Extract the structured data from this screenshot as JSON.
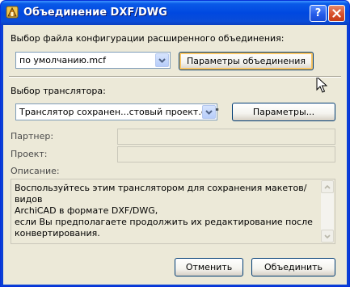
{
  "window": {
    "title": "Объединение DXF/DWG",
    "help_button": "?",
    "close_button": "×",
    "icons": {
      "app": "archicad-app-icon",
      "help": "help-icon",
      "close": "close-icon"
    }
  },
  "config_section": {
    "label": "Выбор файла конфигурации расширенного объединения:",
    "select_value": "по умолчанию.mcf",
    "settings_button": "Параметры объединения"
  },
  "translator_section": {
    "label": "Выбор транслятора:",
    "select_value": "Транслятор сохранен...стовый проект.dxf\"",
    "params_button": "Параметры..."
  },
  "info": {
    "partner_label": "Партнер:",
    "partner_value": "",
    "project_label": "Проект:",
    "project_value": "",
    "description_label": "Описание:",
    "description_lines": [
      "Воспользуйтесь этим транслятором для сохранения макетов/видов",
      "ArchiCAD в формате DXF/DWG,",
      "если Вы предполагаете продолжить их редактирование после",
      "конвертирования."
    ]
  },
  "footer": {
    "cancel_button": "Отменить",
    "merge_button": "Объединить"
  },
  "colors": {
    "titlebar": "#0048e0",
    "dialog_bg": "#ece9d8",
    "button_border": "#003c74",
    "focus_ring": "#f7c463",
    "combo_border": "#7f9db9"
  }
}
